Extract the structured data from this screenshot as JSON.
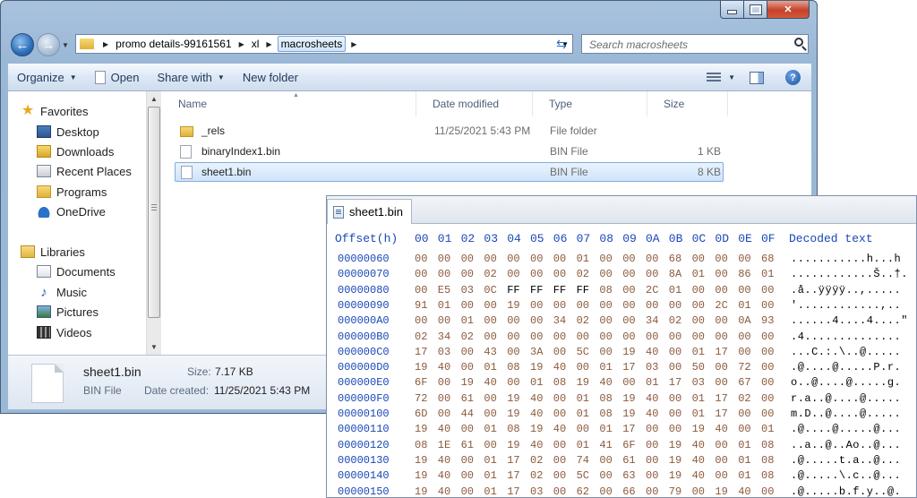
{
  "explorer": {
    "breadcrumb": [
      "promo details-99161561",
      "xl",
      "macrosheets"
    ],
    "search_placeholder": "Search macrosheets",
    "toolbar": {
      "organize": "Organize",
      "open": "Open",
      "share_with": "Share with",
      "new_folder": "New folder"
    },
    "nav": {
      "favorites": "Favorites",
      "desktop": "Desktop",
      "downloads": "Downloads",
      "recent_places": "Recent Places",
      "programs": "Programs",
      "onedrive": "OneDrive",
      "libraries": "Libraries",
      "documents": "Documents",
      "music": "Music",
      "pictures": "Pictures",
      "videos": "Videos"
    },
    "columns": {
      "name": "Name",
      "date": "Date modified",
      "type": "Type",
      "size": "Size"
    },
    "files": [
      {
        "name": "_rels",
        "date": "11/25/2021 5:43 PM",
        "type": "File folder",
        "size": ""
      },
      {
        "name": "binaryIndex1.bin",
        "date": "",
        "type": "BIN File",
        "size": "1 KB"
      },
      {
        "name": "sheet1.bin",
        "date": "",
        "type": "BIN File",
        "size": "8 KB"
      }
    ],
    "details": {
      "filename": "sheet1.bin",
      "filetype": "BIN File",
      "size_label": "Size:",
      "size_value": "7.17 KB",
      "created_label": "Date created:",
      "created_value": "11/25/2021 5:43 PM"
    }
  },
  "hex": {
    "tab": "sheet1.bin",
    "offset_header": "Offset(h)",
    "columns": [
      "00",
      "01",
      "02",
      "03",
      "04",
      "05",
      "06",
      "07",
      "08",
      "09",
      "0A",
      "0B",
      "0C",
      "0D",
      "0E",
      "0F"
    ],
    "decoded_header": "Decoded text",
    "rows": [
      {
        "off": "00000060",
        "bytes": [
          "00",
          "00",
          "00",
          "00",
          "00",
          "00",
          "00",
          "01",
          "00",
          "00",
          "00",
          "68",
          "00",
          "00",
          "00",
          "68"
        ],
        "text": "...........h...h"
      },
      {
        "off": "00000070",
        "bytes": [
          "00",
          "00",
          "00",
          "02",
          "00",
          "00",
          "00",
          "02",
          "00",
          "00",
          "00",
          "8A",
          "01",
          "00",
          "86",
          "01"
        ],
        "text": "............Š..†."
      },
      {
        "off": "00000080",
        "bytes": [
          "00",
          "E5",
          "03",
          "0C",
          "FF",
          "FF",
          "FF",
          "FF",
          "08",
          "00",
          "2C",
          "01",
          "00",
          "00",
          "00",
          "00"
        ],
        "text": ".å..ÿÿÿÿ..,....."
      },
      {
        "off": "00000090",
        "bytes": [
          "91",
          "01",
          "00",
          "00",
          "19",
          "00",
          "00",
          "00",
          "00",
          "00",
          "00",
          "00",
          "00",
          "2C",
          "01",
          "00"
        ],
        "text": "'............,.."
      },
      {
        "off": "000000A0",
        "bytes": [
          "00",
          "00",
          "01",
          "00",
          "00",
          "00",
          "34",
          "02",
          "00",
          "00",
          "34",
          "02",
          "00",
          "00",
          "0A",
          "93"
        ],
        "text": "......4....4....\""
      },
      {
        "off": "000000B0",
        "bytes": [
          "02",
          "34",
          "02",
          "00",
          "00",
          "00",
          "00",
          "00",
          "00",
          "00",
          "00",
          "00",
          "00",
          "00",
          "00",
          "00"
        ],
        "text": ".4.............."
      },
      {
        "off": "000000C0",
        "bytes": [
          "17",
          "03",
          "00",
          "43",
          "00",
          "3A",
          "00",
          "5C",
          "00",
          "19",
          "40",
          "00",
          "01",
          "17",
          "00",
          "00"
        ],
        "text": "...C.:.\\..@....."
      },
      {
        "off": "000000D0",
        "bytes": [
          "19",
          "40",
          "00",
          "01",
          "08",
          "19",
          "40",
          "00",
          "01",
          "17",
          "03",
          "00",
          "50",
          "00",
          "72",
          "00"
        ],
        "text": ".@....@.....P.r."
      },
      {
        "off": "000000E0",
        "bytes": [
          "6F",
          "00",
          "19",
          "40",
          "00",
          "01",
          "08",
          "19",
          "40",
          "00",
          "01",
          "17",
          "03",
          "00",
          "67",
          "00"
        ],
        "text": "o..@....@.....g."
      },
      {
        "off": "000000F0",
        "bytes": [
          "72",
          "00",
          "61",
          "00",
          "19",
          "40",
          "00",
          "01",
          "08",
          "19",
          "40",
          "00",
          "01",
          "17",
          "02",
          "00"
        ],
        "text": "r.a..@....@....."
      },
      {
        "off": "00000100",
        "bytes": [
          "6D",
          "00",
          "44",
          "00",
          "19",
          "40",
          "00",
          "01",
          "08",
          "19",
          "40",
          "00",
          "01",
          "17",
          "00",
          "00"
        ],
        "text": "m.D..@....@....."
      },
      {
        "off": "00000110",
        "bytes": [
          "19",
          "40",
          "00",
          "01",
          "08",
          "19",
          "40",
          "00",
          "01",
          "17",
          "00",
          "00",
          "19",
          "40",
          "00",
          "01"
        ],
        "text": ".@....@.....@..."
      },
      {
        "off": "00000120",
        "bytes": [
          "08",
          "1E",
          "61",
          "00",
          "19",
          "40",
          "00",
          "01",
          "41",
          "6F",
          "00",
          "19",
          "40",
          "00",
          "01",
          "08"
        ],
        "text": "..a..@..Ao..@..."
      },
      {
        "off": "00000130",
        "bytes": [
          "19",
          "40",
          "00",
          "01",
          "17",
          "02",
          "00",
          "74",
          "00",
          "61",
          "00",
          "19",
          "40",
          "00",
          "01",
          "08"
        ],
        "text": ".@.....t.a..@..."
      },
      {
        "off": "00000140",
        "bytes": [
          "19",
          "40",
          "00",
          "01",
          "17",
          "02",
          "00",
          "5C",
          "00",
          "63",
          "00",
          "19",
          "40",
          "00",
          "01",
          "08"
        ],
        "text": ".@.....\\.c..@..."
      },
      {
        "off": "00000150",
        "bytes": [
          "19",
          "40",
          "00",
          "01",
          "17",
          "03",
          "00",
          "62",
          "00",
          "66",
          "00",
          "79",
          "00",
          "19",
          "40",
          "00"
        ],
        "text": ".@.....b.f.y..@."
      }
    ]
  }
}
